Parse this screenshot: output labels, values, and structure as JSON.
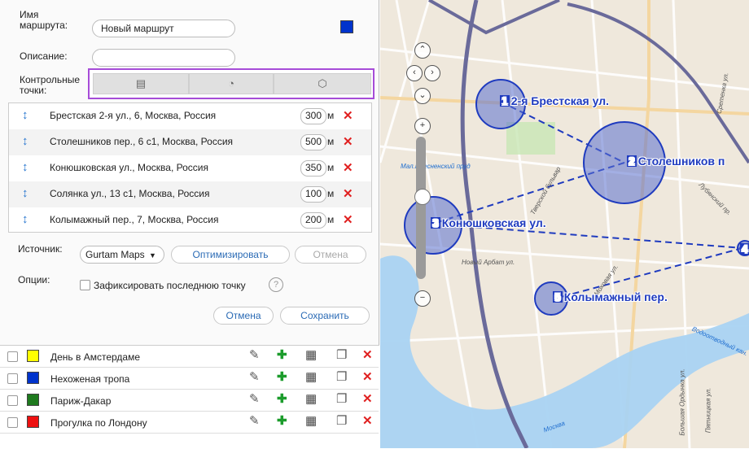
{
  "form": {
    "name_label": "Имя маршрута:",
    "name_value": "Новый маршрут",
    "route_color": "#0033cc",
    "description_label": "Описание:",
    "description_value": "",
    "checkpoints_label": "Контрольные точки:",
    "checkpoint_tool_icons": [
      "table-icon",
      "circle-icon",
      "polygon-icon"
    ]
  },
  "waypoints": [
    {
      "address": "Брестская 2-я ул., 6, Москва, Россия",
      "radius": "300"
    },
    {
      "address": "Столешников пер., 6 с1, Москва, Россия",
      "radius": "500"
    },
    {
      "address": "Конюшковская ул., Москва, Россия",
      "radius": "350"
    },
    {
      "address": "Солянка ул., 13 с1, Москва, Россия",
      "radius": "100"
    },
    {
      "address": "Колымажный пер., 7, Москва, Россия",
      "radius": "200"
    }
  ],
  "waypoint_unit": "м",
  "source": {
    "label": "Источник:",
    "value": "Gurtam Maps",
    "optimize_label": "Оптимизировать",
    "cancel_label": "Отмена"
  },
  "options": {
    "label": "Опции:",
    "fix_last_point_label": "Зафиксировать последнюю точку",
    "help_symbol": "?"
  },
  "actions": {
    "cancel_label": "Отмена",
    "save_label": "Сохранить"
  },
  "routes": [
    {
      "name": "День в Амстердаме",
      "color": "#ffff00"
    },
    {
      "name": "Нехоженая тропа",
      "color": "#0033cc"
    },
    {
      "name": "Париж-Дакар",
      "color": "#1e7a1e"
    },
    {
      "name": "Прогулка по Лондону",
      "color": "#ee1111"
    }
  ],
  "map": {
    "waypoints": [
      {
        "num": "1",
        "label": "2-я Брестская ул."
      },
      {
        "num": "2",
        "label": "Столешников п"
      },
      {
        "num": "3",
        "label": "Конюшковская ул."
      },
      {
        "num": "4",
        "label": ""
      },
      {
        "num": "5",
        "label": "Колымажный пер."
      }
    ],
    "streets": {
      "pond": "Мал.Пресненский пруд",
      "novy_arbat": "Новый Арбат ул.",
      "tverskoy": "Тверской бульвар",
      "mokhovaya": "Моховая ул.",
      "lubyansky": "Лубянский пр.",
      "sretenka": "Сретенка ул.",
      "vodootvodny": "Водоотводный кан.",
      "ordynka": "Большая Ордынка ул.",
      "pyatnitskaya": "Пятницкая ул.",
      "moskva": "Москва"
    }
  }
}
